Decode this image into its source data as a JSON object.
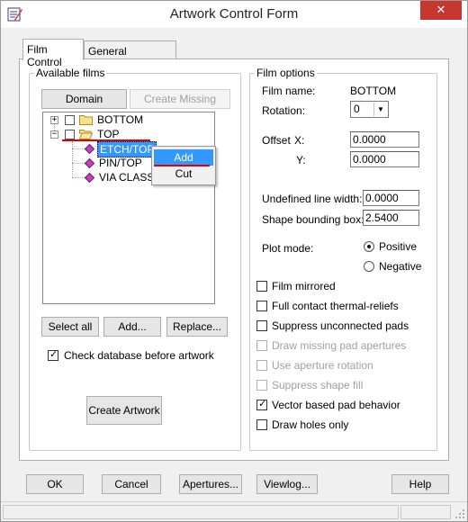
{
  "window": {
    "title": "Artwork Control Form",
    "close_glyph": "✕"
  },
  "tabs": [
    {
      "label": "Film Control"
    },
    {
      "label": "General Parameters"
    }
  ],
  "available_films": {
    "group_label": "Available films",
    "domain_selection": "Domain Selection",
    "create_missing": "Create Missing Films",
    "tree": {
      "bottom": "BOTTOM",
      "top": "TOP",
      "children": [
        "ETCH/TOP",
        "PIN/TOP",
        "VIA CLASS/"
      ]
    },
    "context_menu": [
      "Add",
      "Cut"
    ],
    "select_all": "Select all",
    "add": "Add...",
    "replace": "Replace...",
    "check_db_label": "Check database before artwork",
    "check_db_checked": true,
    "create_artwork": "Create Artwork"
  },
  "film_options": {
    "group_label": "Film options",
    "film_name_label": "Film name:",
    "film_name_value": "BOTTOM",
    "rotation_label": "Rotation:",
    "rotation_value": "0",
    "offset_label": "Offset",
    "x_label": "X:",
    "x_value": "0.0000",
    "y_label": "Y:",
    "y_value": "0.0000",
    "undef_line_label": "Undefined line width:",
    "undef_line_value": "0.0000",
    "shape_bbox_label": "Shape bounding box:",
    "shape_bbox_value": "2.5400",
    "plot_mode_label": "Plot mode:",
    "positive": "Positive",
    "negative": "Negative",
    "plot_mode_selected": "Positive",
    "checkboxes": [
      {
        "label": "Film mirrored",
        "checked": false,
        "enabled": true
      },
      {
        "label": "Full contact thermal-reliefs",
        "checked": false,
        "enabled": true
      },
      {
        "label": "Suppress unconnected pads",
        "checked": false,
        "enabled": true
      },
      {
        "label": "Draw missing pad apertures",
        "checked": false,
        "enabled": false
      },
      {
        "label": "Use aperture rotation",
        "checked": false,
        "enabled": false
      },
      {
        "label": "Suppress shape fill",
        "checked": false,
        "enabled": false
      },
      {
        "label": "Vector based pad behavior",
        "checked": true,
        "enabled": true
      },
      {
        "label": "Draw holes only",
        "checked": false,
        "enabled": true
      }
    ]
  },
  "footer": {
    "ok": "OK",
    "cancel": "Cancel",
    "apertures": "Apertures...",
    "viewlog": "Viewlog...",
    "help": "Help"
  },
  "colors": {
    "selection": "#3399ff",
    "close_button": "#c7372f",
    "annotation": "#e00000"
  }
}
